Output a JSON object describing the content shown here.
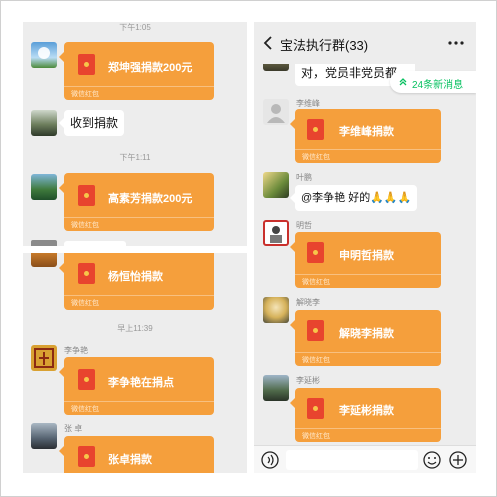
{
  "colors": {
    "redpacket": "#f59f3c",
    "envelope": "#e8442e",
    "badge_text": "#07c160"
  },
  "left_top": {
    "time1": "下午1:05",
    "packet1_title": "郑坤强捐款200元",
    "packet_footer": "微信红包",
    "text_msg": "收到捐款",
    "time2": "下午1:11",
    "packet2_title": "高素芳捐款200元"
  },
  "left_bottom": {
    "packet3_title": "杨恒怡捐款",
    "packet_footer": "微信红包",
    "time": "早上11:39",
    "sender1": "李争艳",
    "packet4_title": "李争艳在捐点",
    "sender2": "张  卓",
    "packet5_title": "张卓捐款"
  },
  "right": {
    "back_icon": "chevron-left-icon",
    "title": "宝法执行群(33)",
    "more_icon": "more-icon",
    "msg1_text": "对，党员非党员都",
    "new_badge": "24条新消息",
    "sender1": "李维峰",
    "packet1_title": "李维峰捐款",
    "packet_footer": "微信红包",
    "sender2": "叶鹏",
    "msg2_text": "@李争艳  好的🙏🙏🙏",
    "sender3": "明哲",
    "packet2_title": "申明哲捐款",
    "sender4": "解晓李",
    "packet3_title": "解晓李捐款",
    "sender5": "李延彬",
    "packet4_title": "李延彬捐款",
    "voice_icon": "voice-icon",
    "emoji_icon": "emoji-icon",
    "plus_icon": "plus-icon"
  }
}
